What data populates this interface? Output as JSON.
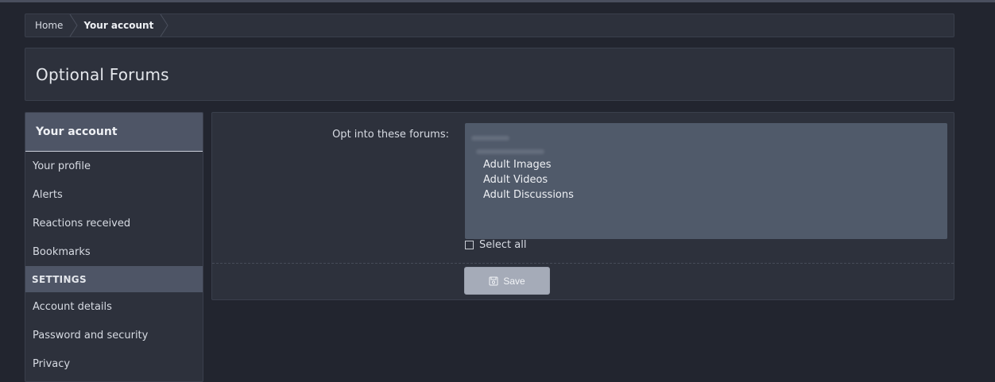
{
  "breadcrumb": {
    "items": [
      "Home",
      "Your account"
    ]
  },
  "page": {
    "title": "Optional Forums"
  },
  "sidebar": {
    "header": "Your account",
    "items": [
      "Your profile",
      "Alerts",
      "Reactions received",
      "Bookmarks"
    ],
    "section": "SETTINGS",
    "settings_items": [
      "Account details",
      "Password and security",
      "Privacy"
    ]
  },
  "form": {
    "label": "Opt into these forums:",
    "options": [
      "Adult Images",
      "Adult Videos",
      "Adult Discussions"
    ],
    "select_all": "Select all",
    "save": "Save"
  },
  "icons": {
    "save": "save-icon",
    "separator": "chevron-right-icon"
  }
}
